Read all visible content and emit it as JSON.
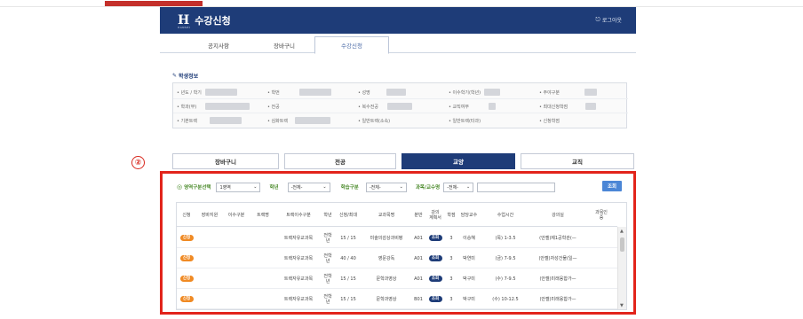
{
  "header": {
    "logo_mark": "H",
    "logo_sub": "HANSEI",
    "title": "수강신청",
    "logout_label": "로그아웃",
    "logout_icon": "logout-icon",
    "brand_color": "#1e3c78"
  },
  "tabs": [
    {
      "label": "공지사항"
    },
    {
      "label": "장바구니"
    },
    {
      "label": "수강신청"
    }
  ],
  "student_info": {
    "title": "학생정보",
    "rows": [
      [
        "• 년도 / 학기",
        "• 학번",
        "• 성명",
        "• 이수학기(학년)",
        "• 주야구분"
      ],
      [
        "• 학과(부)",
        "• 전공",
        "• 복수전공",
        "• 교직여부",
        "• 최대신청학점"
      ],
      [
        "• 기본트랙",
        "• 심화트랙",
        "• 일반트랙(소속)",
        "• 일반트랙(타과)",
        "• 신청학점"
      ]
    ]
  },
  "categories": [
    {
      "label": "장바구니"
    },
    {
      "label": "전공"
    },
    {
      "label": "교양"
    },
    {
      "label": "교직"
    }
  ],
  "annotation": "②",
  "filter": {
    "area_label": "영역구분선택",
    "area_value": "1영역",
    "year_label": "학년",
    "year_value": "-전체-",
    "type_label": "학습구분",
    "type_value": "-전체-",
    "course_label": "과목/교수명",
    "course_value": "-전체-",
    "search_button": "조회"
  },
  "table": {
    "headers": [
      "신청",
      "장바지원",
      "이수구분",
      "트랙명",
      "트랙이수구분",
      "학년",
      "신청/최대",
      "교과목명",
      "분반",
      "강의\n계획서",
      "학점",
      "담당교수",
      "수업시간",
      "강의실",
      "과목인\n증"
    ],
    "rows": [
      {
        "apply": "신청",
        "track_type": "트랙자유교과목",
        "grade": "전학\n년",
        "count": "15 / 15",
        "course": "미술의감상과비평",
        "section": "A01",
        "plan": "조회",
        "credit": "3",
        "prof": "이승혜",
        "time": "(목) 1-3.5",
        "room": "(안젤)제1공학관(—"
      },
      {
        "apply": "신청",
        "track_type": "트랙자유교과목",
        "grade": "전학\n년",
        "count": "40 / 40",
        "course": "영문강독",
        "section": "A01",
        "plan": "조회",
        "credit": "3",
        "prof": "박연미",
        "time": "(금) 7-9.5",
        "room": "(안젤)자성건물(일—"
      },
      {
        "apply": "신청",
        "track_type": "트랙자유교과목",
        "grade": "전학\n년",
        "count": "15 / 15",
        "course": "문학과영상",
        "section": "A01",
        "plan": "조회",
        "credit": "3",
        "prof": "박구미",
        "time": "(수) 7-9.5",
        "room": "(안젤)미래융합가—"
      },
      {
        "apply": "신청",
        "track_type": "트랙자유교과목",
        "grade": "전학\n년",
        "count": "15 / 15",
        "course": "문학과영상",
        "section": "B01",
        "plan": "조회",
        "credit": "3",
        "prof": "박구미",
        "time": "(수) 10-12.5",
        "room": "(안젤)미래융합가—"
      }
    ]
  },
  "colors": {
    "highlight_frame": "#e2241b",
    "apply_button": "#f08a24",
    "active_category": "#1e3c78",
    "search_button": "#4b86d6"
  }
}
